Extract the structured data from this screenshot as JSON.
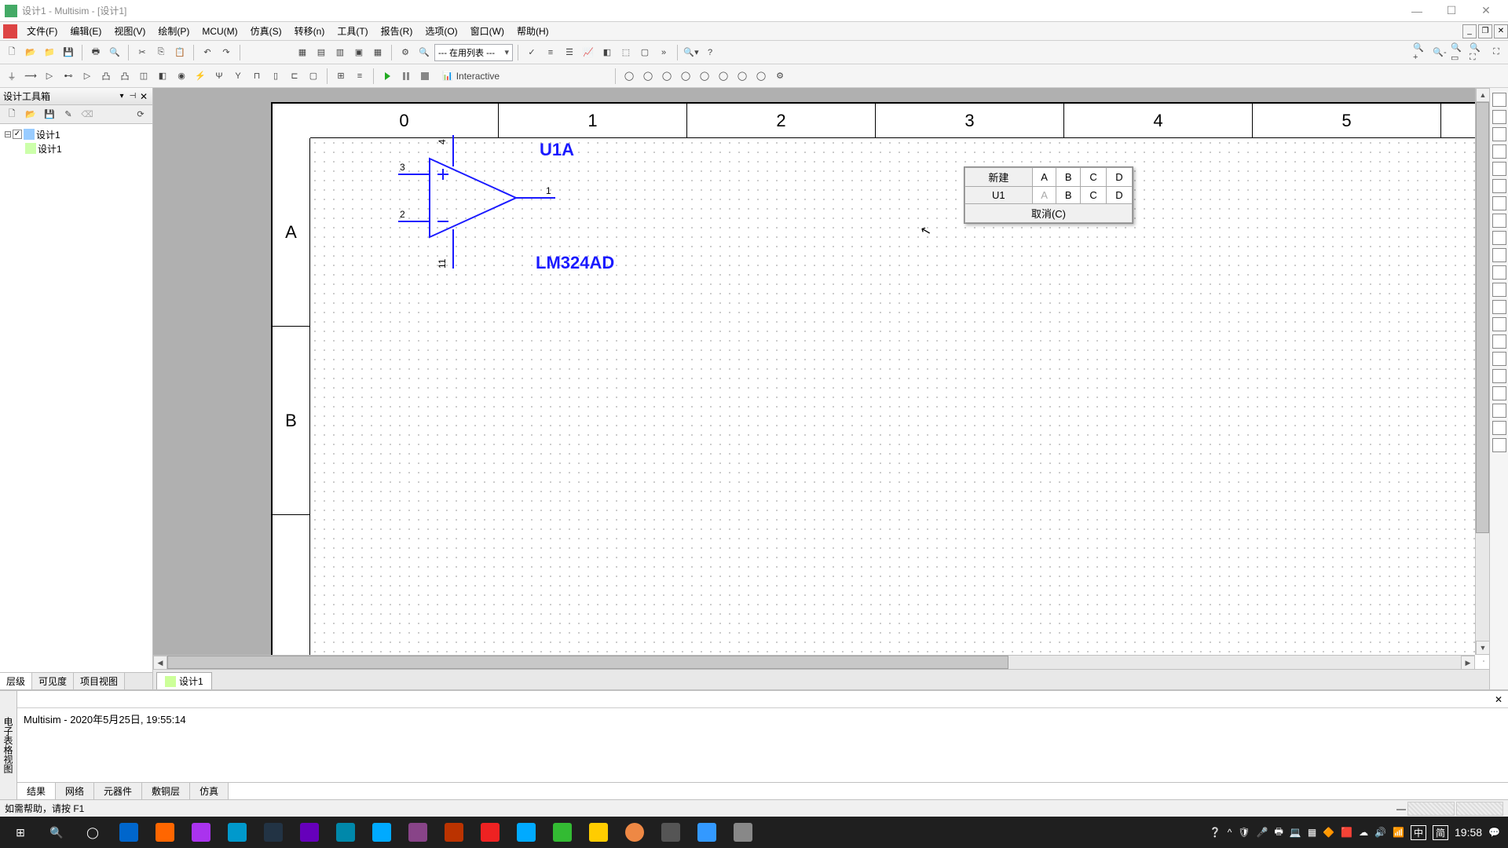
{
  "title": "设计1 - Multisim - [设计1]",
  "menu": [
    "文件(F)",
    "编辑(E)",
    "视图(V)",
    "绘制(P)",
    "MCU(M)",
    "仿真(S)",
    "转移(n)",
    "工具(T)",
    "报告(R)",
    "选项(O)",
    "窗口(W)",
    "帮助(H)"
  ],
  "toolbar1_combo": "--- 在用列表 ---",
  "toolbar2_mode": "Interactive",
  "sidebar": {
    "title": "设计工具箱",
    "tree": {
      "root": "设计1",
      "child": "设计1"
    },
    "tabs": [
      "层级",
      "可见度",
      "项目视图"
    ]
  },
  "ruler_top": [
    "0",
    "1",
    "2",
    "3",
    "4",
    "5"
  ],
  "ruler_left": [
    "A",
    "B"
  ],
  "component": {
    "ref": "U1A",
    "value": "LM324AD",
    "pins": {
      "p1": "1",
      "p2": "2",
      "p3": "3",
      "p4": "4",
      "p11": "11"
    }
  },
  "section_popup": {
    "new": "新建",
    "u1": "U1",
    "cols": [
      "A",
      "B",
      "C",
      "D"
    ],
    "row2": [
      "A",
      "B",
      "C",
      "D"
    ],
    "cancel": "取消(C)"
  },
  "doctab": "设计1",
  "output": {
    "text": "Multisim  -  2020年5月25日, 19:55:14",
    "side_tab": "电子表格视图",
    "tabs": [
      "结果",
      "网络",
      "元器件",
      "敷铜层",
      "仿真"
    ]
  },
  "statusbar": "如需帮助，请按 F1",
  "taskbar": {
    "ime": "中",
    "ime2": "简",
    "time": "19:58"
  }
}
